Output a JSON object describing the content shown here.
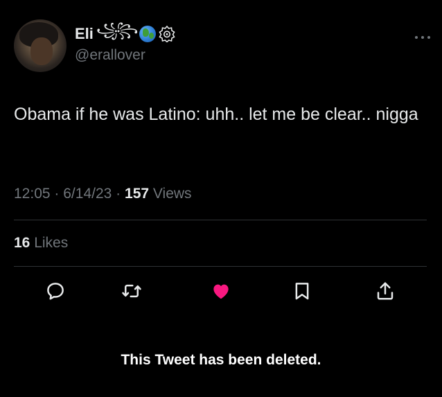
{
  "author": {
    "display_name": "Eli",
    "name_flourish": "꧁꧂",
    "handle": "@erallover",
    "badges": [
      "globe-icon",
      "settings-badge-icon"
    ]
  },
  "tweet": {
    "text": "Obama if he was Latino: uhh.. let me be clear.. nigga",
    "time": "12:05",
    "separator_1": "·",
    "date": "6/14/23",
    "separator_2": "·",
    "views_count": "157",
    "views_label": "Views"
  },
  "engagement": {
    "likes_count": "16",
    "likes_label": "Likes"
  },
  "actions": [
    {
      "name": "reply-icon"
    },
    {
      "name": "retweet-icon"
    },
    {
      "name": "like-icon",
      "active": true
    },
    {
      "name": "bookmark-icon"
    },
    {
      "name": "share-icon"
    }
  ],
  "status": {
    "deleted_message": "This Tweet has been deleted."
  },
  "colors": {
    "background": "#000000",
    "text_primary": "#e7e9ea",
    "text_secondary": "#71767b",
    "divider": "#2f3336",
    "like_active": "#f91880"
  }
}
